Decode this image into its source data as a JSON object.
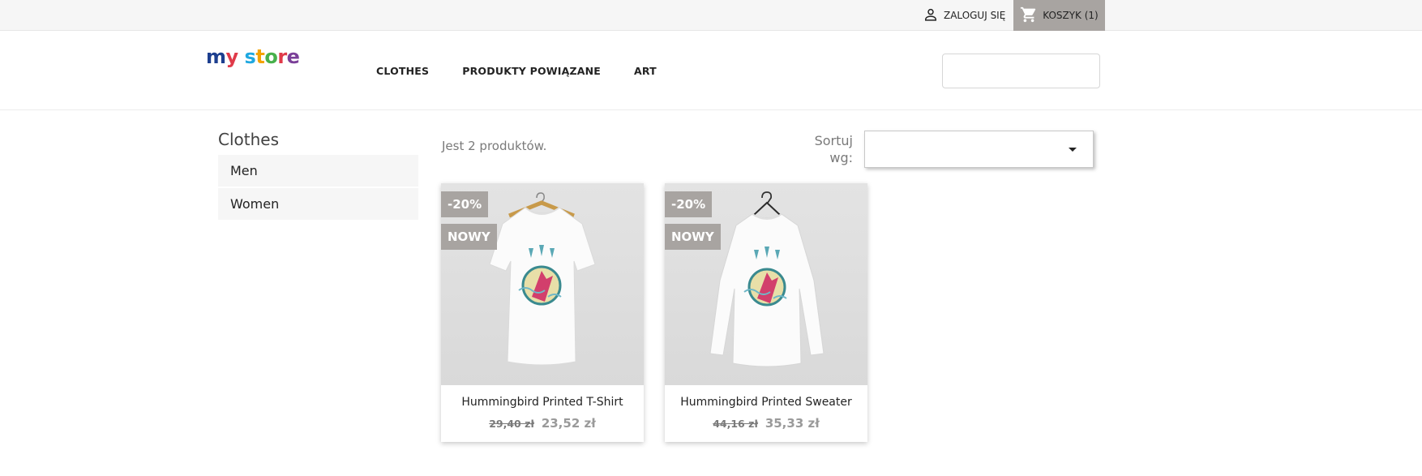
{
  "topbar": {
    "login_label": "ZALOGUJ SIĘ",
    "cart_label": "KOSZYK (1)"
  },
  "header": {
    "logo_text": [
      "m",
      "y",
      " ",
      "s",
      "t",
      "o",
      "r",
      "e"
    ],
    "logo_colors": [
      "#1d3f8f",
      "#e03a49",
      "#ffffff",
      "#1fa8e0",
      "#f4a300",
      "#47b04b",
      "#e03a49",
      "#7a3f98"
    ],
    "nav": [
      "CLOTHES",
      "PRODUKTY POWIĄZANE",
      "ART"
    ],
    "search_placeholder": ""
  },
  "sidebar": {
    "title": "Clothes",
    "items": [
      "Men",
      "Women"
    ]
  },
  "listing": {
    "count_text": "Jest 2 produktów.",
    "sort_label_line1": "Sortuj",
    "sort_label_line2": "wg:",
    "sort_selected": ""
  },
  "products": [
    {
      "name": "Hummingbird Printed T-Shirt",
      "old_price": "29,40 zł",
      "new_price": "23,52 zł",
      "discount": "-20%",
      "flag": "NOWY"
    },
    {
      "name": "Hummingbird Printed Sweater",
      "old_price": "44,16 zł",
      "new_price": "35,33 zł",
      "discount": "-20%",
      "flag": "NOWY"
    }
  ],
  "colors": {
    "flag_bg": "#a8a4a1",
    "topbar_bg": "#f6f6f6"
  }
}
